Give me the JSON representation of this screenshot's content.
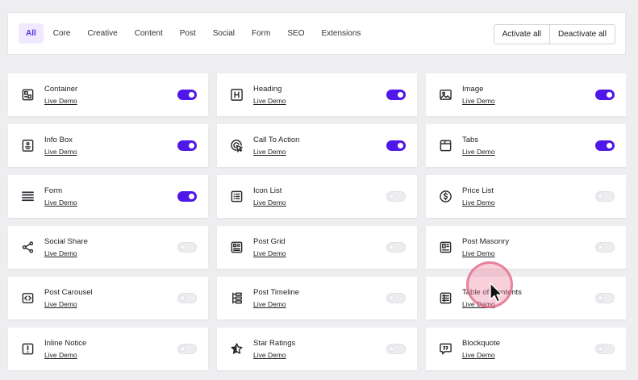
{
  "filters": {
    "tabs": [
      "All",
      "Core",
      "Creative",
      "Content",
      "Post",
      "Social",
      "Form",
      "SEO",
      "Extensions"
    ],
    "active_tab": "All",
    "activate_all": "Activate all",
    "deactivate_all": "Deactivate all"
  },
  "colors": {
    "accent": "#4f17e8",
    "active_tab_bg": "#efeaff",
    "toggle_off": "#ededf0",
    "background": "#eeeef0",
    "cursor_highlight": "#e87c9c"
  },
  "widgets": [
    {
      "title": "Container",
      "icon": "container-icon",
      "demo": "Live Demo",
      "enabled": true
    },
    {
      "title": "Heading",
      "icon": "heading-icon",
      "demo": "Live Demo",
      "enabled": true
    },
    {
      "title": "Image",
      "icon": "image-icon",
      "demo": "Live Demo",
      "enabled": true
    },
    {
      "title": "Info Box",
      "icon": "info-box-icon",
      "demo": "Live Demo",
      "enabled": true
    },
    {
      "title": "Call To Action",
      "icon": "call-to-action-icon",
      "demo": "Live Demo",
      "enabled": true
    },
    {
      "title": "Tabs",
      "icon": "tabs-icon",
      "demo": "Live Demo",
      "enabled": true
    },
    {
      "title": "Form",
      "icon": "form-icon",
      "demo": "Live Demo",
      "enabled": true
    },
    {
      "title": "Icon List",
      "icon": "icon-list-icon",
      "demo": "Live Demo",
      "enabled": false
    },
    {
      "title": "Price List",
      "icon": "price-list-icon",
      "demo": "Live Demo",
      "enabled": false
    },
    {
      "title": "Social Share",
      "icon": "social-share-icon",
      "demo": "Live Demo",
      "enabled": false
    },
    {
      "title": "Post Grid",
      "icon": "post-grid-icon",
      "demo": "Live Demo",
      "enabled": false
    },
    {
      "title": "Post Masonry",
      "icon": "post-masonry-icon",
      "demo": "Live Demo",
      "enabled": false
    },
    {
      "title": "Post Carousel",
      "icon": "post-carousel-icon",
      "demo": "Live Demo",
      "enabled": false
    },
    {
      "title": "Post Timeline",
      "icon": "post-timeline-icon",
      "demo": "Live Demo",
      "enabled": false
    },
    {
      "title": "Table of Contents",
      "icon": "table-of-contents-icon",
      "demo": "Live Demo",
      "enabled": false
    },
    {
      "title": "Inline Notice",
      "icon": "inline-notice-icon",
      "demo": "Live Demo",
      "enabled": false
    },
    {
      "title": "Star Ratings",
      "icon": "star-ratings-icon",
      "demo": "Live Demo",
      "enabled": false
    },
    {
      "title": "Blockquote",
      "icon": "blockquote-icon",
      "demo": "Live Demo",
      "enabled": false
    }
  ]
}
